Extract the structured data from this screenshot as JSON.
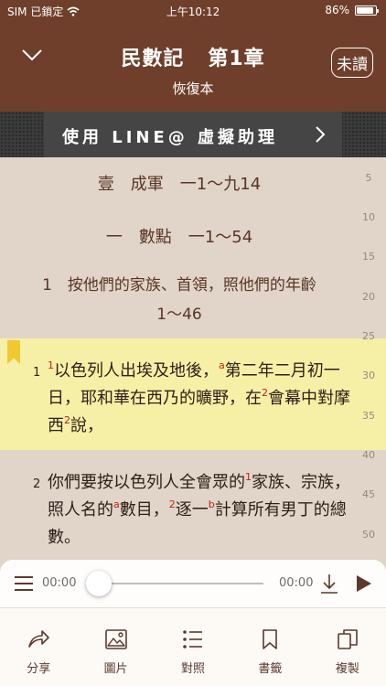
{
  "status": {
    "carrier": "SIM 已鎖定",
    "time": "上午10:12",
    "battery": "86%",
    "battery_level": 0.86
  },
  "header": {
    "book": "民數記",
    "chapter": "第1章",
    "version": "恢復本",
    "unread": "未讀"
  },
  "banner": {
    "text": "使用 LINE@ 虛擬助理"
  },
  "line_numbers": [
    "5",
    "10",
    "15",
    "20",
    "25",
    "30",
    "35",
    "40",
    "45",
    "50"
  ],
  "outline": {
    "o1": "壹　成軍　一1～九14",
    "o2": "一　數點　一1～54",
    "o3_num": "1",
    "o3_line1": "按他們的家族、首領，照他們的年齡",
    "o3_line2": "1～46"
  },
  "verses": [
    {
      "num": "1",
      "parts": [
        {
          "t": "sup",
          "v": "1"
        },
        {
          "t": "text",
          "v": "以色列人出埃及地後，"
        },
        {
          "t": "sup",
          "v": "a"
        },
        {
          "t": "text",
          "v": "第二年二月初一日，耶和華在西乃的曠野，在"
        },
        {
          "t": "sup",
          "v": "2"
        },
        {
          "t": "text",
          "v": "會幕中對摩西"
        },
        {
          "t": "sup",
          "v": "2"
        },
        {
          "t": "text",
          "v": "說，"
        }
      ]
    },
    {
      "num": "2",
      "parts": [
        {
          "t": "text",
          "v": "你們要按以色列人全會眾的"
        },
        {
          "t": "sup",
          "v": "1"
        },
        {
          "t": "text",
          "v": "家族、宗族，照人名的"
        },
        {
          "t": "sup",
          "v": "a"
        },
        {
          "t": "text",
          "v": "數目，"
        },
        {
          "t": "sup",
          "v": "2"
        },
        {
          "t": "text",
          "v": "逐一"
        },
        {
          "t": "sup",
          "v": "b"
        },
        {
          "t": "text",
          "v": "計算所有男丁的總數。"
        }
      ]
    }
  ],
  "player": {
    "current": "00:00",
    "total": "00:00",
    "progress": 0
  },
  "toolbar": [
    {
      "label": "分享",
      "icon": "share-icon"
    },
    {
      "label": "圖片",
      "icon": "image-icon"
    },
    {
      "label": "對照",
      "icon": "compare-icon"
    },
    {
      "label": "書籤",
      "icon": "bookmark-icon"
    },
    {
      "label": "複製",
      "icon": "copy-icon"
    }
  ],
  "colors": {
    "header": "#6f3f2b",
    "background": "#e0d5c8",
    "highlight": "#f6f0a6",
    "footnote": "#c0201c"
  }
}
